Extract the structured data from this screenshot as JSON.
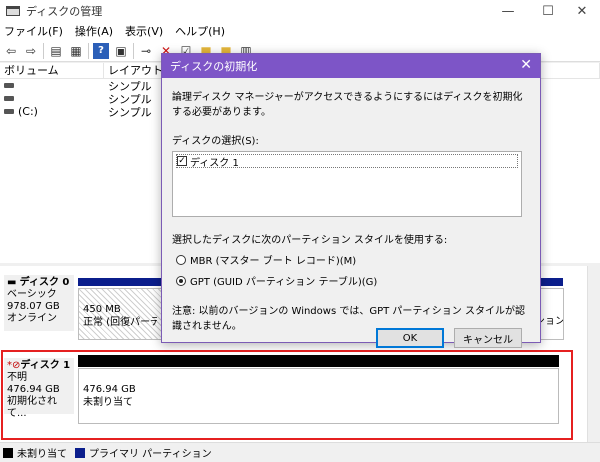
{
  "window": {
    "title": "ディスクの管理",
    "controls": [
      "—",
      "☐",
      "✕"
    ]
  },
  "menu": [
    "ファイル(F)",
    "操作(A)",
    "表示(V)",
    "ヘルプ(H)"
  ],
  "list": {
    "columns": [
      "ボリューム",
      "レイアウト"
    ],
    "rows": [
      {
        "volume": "",
        "layout": "シンプル"
      },
      {
        "volume": "",
        "layout": "シンプル"
      },
      {
        "volume": "(C:)",
        "layout": "シンプル"
      }
    ]
  },
  "disks": [
    {
      "name": "ディスク 0",
      "type": "ベーシック",
      "size": "978.07 GB",
      "status": "オンライン",
      "partition": {
        "size": "450 MB",
        "status": "正常 (回復パーティ"
      },
      "right_fragment": "ジション)"
    },
    {
      "name": "ディスク 1",
      "type": "不明",
      "size": "476.94 GB",
      "status": "初期化されて...",
      "partition": {
        "size": "476.94 GB",
        "status": "未割り当て"
      }
    }
  ],
  "legend": [
    {
      "label": "未割り当て",
      "color": "#000000"
    },
    {
      "label": "プライマリ パーティション",
      "color": "#0b1e8c"
    }
  ],
  "dialog": {
    "title": "ディスクの初期化",
    "message": "論理ディスク マネージャーがアクセスできるようにするにはディスクを初期化する必要があります。",
    "select_label": "ディスクの選択(S):",
    "disk_item": "ディスク 1",
    "style_label": "選択したディスクに次のパーティション スタイルを使用する:",
    "options": [
      "MBR (マスター ブート レコード)(M)",
      "GPT (GUID パーティション テーブル)(G)"
    ],
    "note": "注意: 以前のバージョンの Windows では、GPT パーティション スタイルが認識されません。",
    "ok": "OK",
    "cancel": "キャンセル",
    "close": "✕"
  },
  "colors": {
    "dialog_title": "#7d55c7",
    "highlight_box": "#e52020"
  }
}
